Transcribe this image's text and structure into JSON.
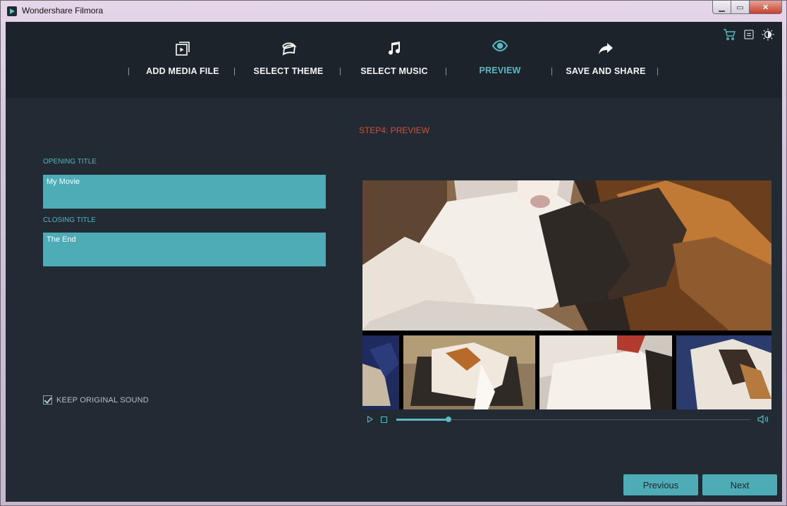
{
  "window": {
    "title": "Wondershare Filmora",
    "minimize": "▁",
    "maximize": "▭",
    "close": "✕"
  },
  "nav": {
    "items": [
      {
        "label": "ADD MEDIA FILE",
        "icon": "media-file-icon"
      },
      {
        "label": "SELECT THEME",
        "icon": "theme-icon"
      },
      {
        "label": "SELECT MUSIC",
        "icon": "music-icon"
      },
      {
        "label": "PREVIEW",
        "icon": "eye-icon",
        "active": true
      },
      {
        "label": "SAVE AND SHARE",
        "icon": "share-arrow-icon"
      }
    ],
    "toolbar_icons": [
      "cart-icon",
      "menu-icon",
      "theme-toggle-icon"
    ]
  },
  "step": {
    "title": "STEP4: PREVIEW"
  },
  "form": {
    "opening_label": "OPENING TITLE",
    "opening_value": "My Movie",
    "closing_label": "CLOSING TITLE",
    "closing_value": "The End",
    "keep_sound_label": "KEEP ORIGINAL SOUND",
    "keep_sound_checked": true
  },
  "player": {
    "progress": 0.147
  },
  "buttons": {
    "previous": "Previous",
    "next": "Next"
  },
  "colors": {
    "accent": "#4eacb6",
    "step_title": "#d4503a",
    "panel": "#222a33",
    "nav_bg": "#1c232b"
  }
}
